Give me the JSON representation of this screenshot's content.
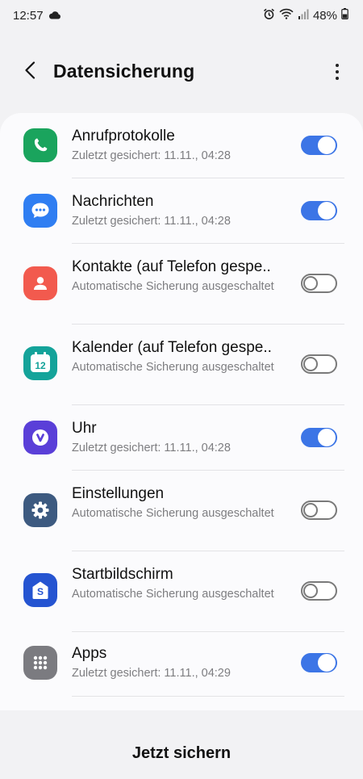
{
  "status_bar": {
    "time": "12:57",
    "battery_percent": "48%",
    "icons": [
      "cloud-icon",
      "alarm-icon",
      "wifi-icon",
      "signal-icon",
      "battery-icon"
    ]
  },
  "header": {
    "title": "Datensicherung",
    "back_icon": "chevron-left-icon",
    "more_icon": "more-vertical-icon"
  },
  "items": [
    {
      "title": "Anrufprotokolle",
      "subtitle": "Zuletzt gesichert: 11.11., 04:28",
      "enabled": true,
      "icon": "phone-icon",
      "icon_color": "#1aa45d"
    },
    {
      "title": "Nachrichten",
      "subtitle": "Zuletzt gesichert: 11.11., 04:28",
      "enabled": true,
      "icon": "chat-bubble-icon",
      "icon_color": "#2f7ef2"
    },
    {
      "title": "Kontakte (auf Telefon gespe..",
      "subtitle": "Automatische Sicherung ausgeschaltet",
      "enabled": false,
      "icon": "contact-icon",
      "icon_color": "#f25a4e"
    },
    {
      "title": "Kalender (auf Telefon gespe..",
      "subtitle": "Automatische Sicherung ausgeschaltet",
      "enabled": false,
      "icon": "calendar-icon",
      "icon_color": "#14a39a",
      "icon_text": "12"
    },
    {
      "title": "Uhr",
      "subtitle": "Zuletzt gesichert: 11.11., 04:28",
      "enabled": true,
      "icon": "clock-icon",
      "icon_color": "#5a3fd8"
    },
    {
      "title": "Einstellungen",
      "subtitle": "Automatische Sicherung ausgeschaltet",
      "enabled": false,
      "icon": "gear-icon",
      "icon_color": "#3d5a80"
    },
    {
      "title": "Startbildschirm",
      "subtitle": "Automatische Sicherung ausgeschaltet",
      "enabled": false,
      "icon": "home-screen-icon",
      "icon_color": "#2554d1",
      "icon_text": "S"
    },
    {
      "title": "Apps",
      "subtitle": "Zuletzt gesichert: 11.11., 04:29",
      "enabled": true,
      "icon": "apps-grid-icon",
      "icon_color": "#7b7b80"
    }
  ],
  "footer": {
    "action_label": "Jetzt sichern"
  },
  "colors": {
    "toggle_on": "#3c75e6",
    "background": "#f2f2f4",
    "card": "#fbfbfd"
  }
}
